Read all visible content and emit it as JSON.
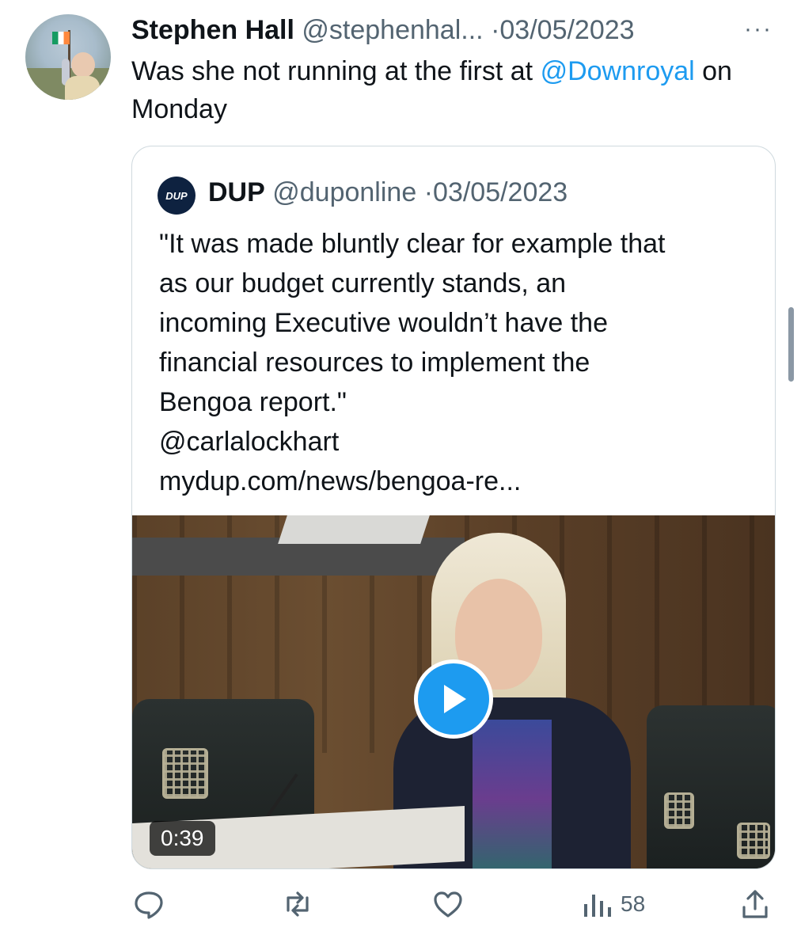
{
  "tweet": {
    "author_name": "Stephen Hall",
    "handle": "@stephenhal...",
    "separator": "·",
    "date": "03/05/2023",
    "more_label": "···",
    "text_before": "Was she not running at the first at ",
    "mention": "@Downroyal",
    "text_after": " on Monday"
  },
  "quote": {
    "avatar_label": "DUP",
    "author_name": "DUP",
    "handle": "@duponline",
    "separator": "·",
    "date": "03/05/2023",
    "lines": [
      "\"It was made bluntly clear for example that",
      "as our budget currently stands, an",
      "incoming Executive wouldn’t have the",
      "financial resources to implement the",
      "Bengoa report.\"",
      "@carlalockhart",
      "mydup.com/news/bengoa-re..."
    ],
    "video": {
      "duration": "0:39"
    }
  },
  "actions": {
    "reply_icon": "reply-icon",
    "retweet_icon": "retweet-icon",
    "like_icon": "like-icon",
    "views_icon": "views-icon",
    "views_count": "58",
    "share_icon": "share-icon"
  },
  "colors": {
    "accent": "#1d9bf0",
    "text": "#0f1419",
    "secondary": "#536471",
    "border": "#cfd9de"
  }
}
